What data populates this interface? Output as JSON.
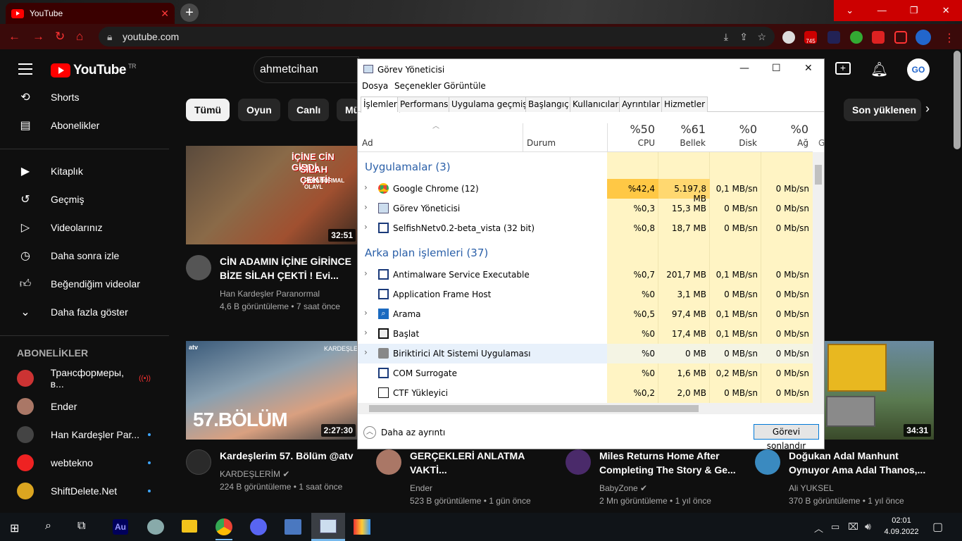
{
  "browser": {
    "tab_title": "YouTube",
    "url": "youtube.com",
    "ext_badge": "745"
  },
  "yt": {
    "region": "TR",
    "logo": "YouTube",
    "search_value": "ahmetcihan",
    "sidebar": [
      {
        "label": "Shorts",
        "icon": "shorts-icon"
      },
      {
        "label": "Abonelikler",
        "icon": "subscriptions-icon"
      },
      {
        "label": "Kitaplık",
        "icon": "library-icon"
      },
      {
        "label": "Geçmiş",
        "icon": "history-icon"
      },
      {
        "label": "Videolarınız",
        "icon": "your-videos-icon"
      },
      {
        "label": "Daha sonra izle",
        "icon": "watch-later-icon"
      },
      {
        "label": "Beğendiğim videolar",
        "icon": "like-icon"
      },
      {
        "label": "Daha fazla göster",
        "icon": "chevron-down-icon"
      }
    ],
    "subs_heading": "ABONELİKLER",
    "subs": [
      "Трансформеры, в...",
      "Ender",
      "Han Kardeşler Par...",
      "webtekno",
      "ShiftDelete.Net"
    ],
    "chips": [
      "Tümü",
      "Oyun",
      "Canlı",
      "Mü",
      "Son yüklenen"
    ],
    "videos": [
      {
        "title1": "CİN ADAMIN İÇİNE GİRİNCE",
        "title2": "BİZE SİLAH ÇEKTİ ! Evi...",
        "channel": "Han Kardeşler Paranormal",
        "meta": "4,6 B görüntüleme • 7 saat önce",
        "duration": "32:51",
        "thumb_text1": "İÇİNE CİN GİRDİ",
        "thumb_text2": "SİLAH ÇEKTİ!",
        "thumb_text3": "PARANORMAL OLAYL"
      },
      {
        "title1": "Kardeşlerim 57. Bölüm @atv",
        "title2": "",
        "channel": "KARDEŞLERİM",
        "meta": "224 B görüntüleme • 1 saat önce",
        "duration": "2:27:30",
        "thumb_text1": "57.BÖLÜM",
        "thumb_text2": "KARDEŞLE",
        "thumb_text3": "atv"
      },
      {
        "title1": "GERÇEKLERİ ANLATMA",
        "title2": "VAKTİ...",
        "channel": "Ender",
        "meta": "523 B görüntüleme • 1 gün önce"
      },
      {
        "title1": "Miles Returns Home After",
        "title2": "Completing The Story & Ge...",
        "channel": "BabyZone",
        "meta": "2 Mn görüntüleme • 1 yıl önce"
      },
      {
        "title1": "Doğukan Adal Manhunt",
        "title2": "Oynuyor Ama Adal Thanos,...",
        "channel": "Ali YUKSEL",
        "meta": "370 B görüntüleme • 1 yıl önce",
        "duration": "34:31"
      }
    ]
  },
  "tm": {
    "title": "Görev Yöneticisi",
    "menu": [
      "Dosya",
      "Seçenekler",
      "Görüntüle"
    ],
    "tabs": [
      "İşlemler",
      "Performans",
      "Uygulama geçmişi",
      "Başlangıç",
      "Kullanıcılar",
      "Ayrıntılar",
      "Hizmetler"
    ],
    "col_name": "Ad",
    "col_status": "Durum",
    "cols": [
      {
        "pct": "%50",
        "label": "CPU"
      },
      {
        "pct": "%61",
        "label": "Bellek"
      },
      {
        "pct": "%0",
        "label": "Disk"
      },
      {
        "pct": "%0",
        "label": "Ağ"
      }
    ],
    "col_extra": "G",
    "group_apps": "Uygulamalar (3)",
    "group_bg": "Arka plan işlemleri (37)",
    "apps": [
      {
        "name": "Google Chrome (12)",
        "cpu": "%42,4",
        "mem": "5.197,8 MB",
        "disk": "0,1 MB/sn",
        "net": "0 Mb/sn"
      },
      {
        "name": "Görev Yöneticisi",
        "cpu": "%0,3",
        "mem": "15,3 MB",
        "disk": "0 MB/sn",
        "net": "0 Mb/sn"
      },
      {
        "name": "SelfishNetv0.2-beta_vista (32 bit)",
        "cpu": "%0,8",
        "mem": "18,7 MB",
        "disk": "0 MB/sn",
        "net": "0 Mb/sn"
      }
    ],
    "bg": [
      {
        "name": "Antimalware Service Executable",
        "cpu": "%0,7",
        "mem": "201,7 MB",
        "disk": "0,1 MB/sn",
        "net": "0 Mb/sn"
      },
      {
        "name": "Application Frame Host",
        "cpu": "%0",
        "mem": "3,1 MB",
        "disk": "0 MB/sn",
        "net": "0 Mb/sn"
      },
      {
        "name": "Arama",
        "cpu": "%0,5",
        "mem": "97,4 MB",
        "disk": "0,1 MB/sn",
        "net": "0 Mb/sn"
      },
      {
        "name": "Başlat",
        "cpu": "%0",
        "mem": "17,4 MB",
        "disk": "0,1 MB/sn",
        "net": "0 Mb/sn"
      },
      {
        "name": "Biriktirici Alt Sistemi Uygulaması",
        "cpu": "%0",
        "mem": "0 MB",
        "disk": "0 MB/sn",
        "net": "0 Mb/sn"
      },
      {
        "name": "COM Surrogate",
        "cpu": "%0",
        "mem": "1,6 MB",
        "disk": "0,2 MB/sn",
        "net": "0 Mb/sn"
      },
      {
        "name": "CTF Yükleyici",
        "cpu": "%0,2",
        "mem": "2,0 MB",
        "disk": "0 MB/sn",
        "net": "0 Mb/sn"
      }
    ],
    "less_details": "Daha az ayrıntı",
    "end_task": "Görevi sonlandır"
  },
  "taskbar": {
    "time": "02:01",
    "date": "4.09.2022"
  }
}
